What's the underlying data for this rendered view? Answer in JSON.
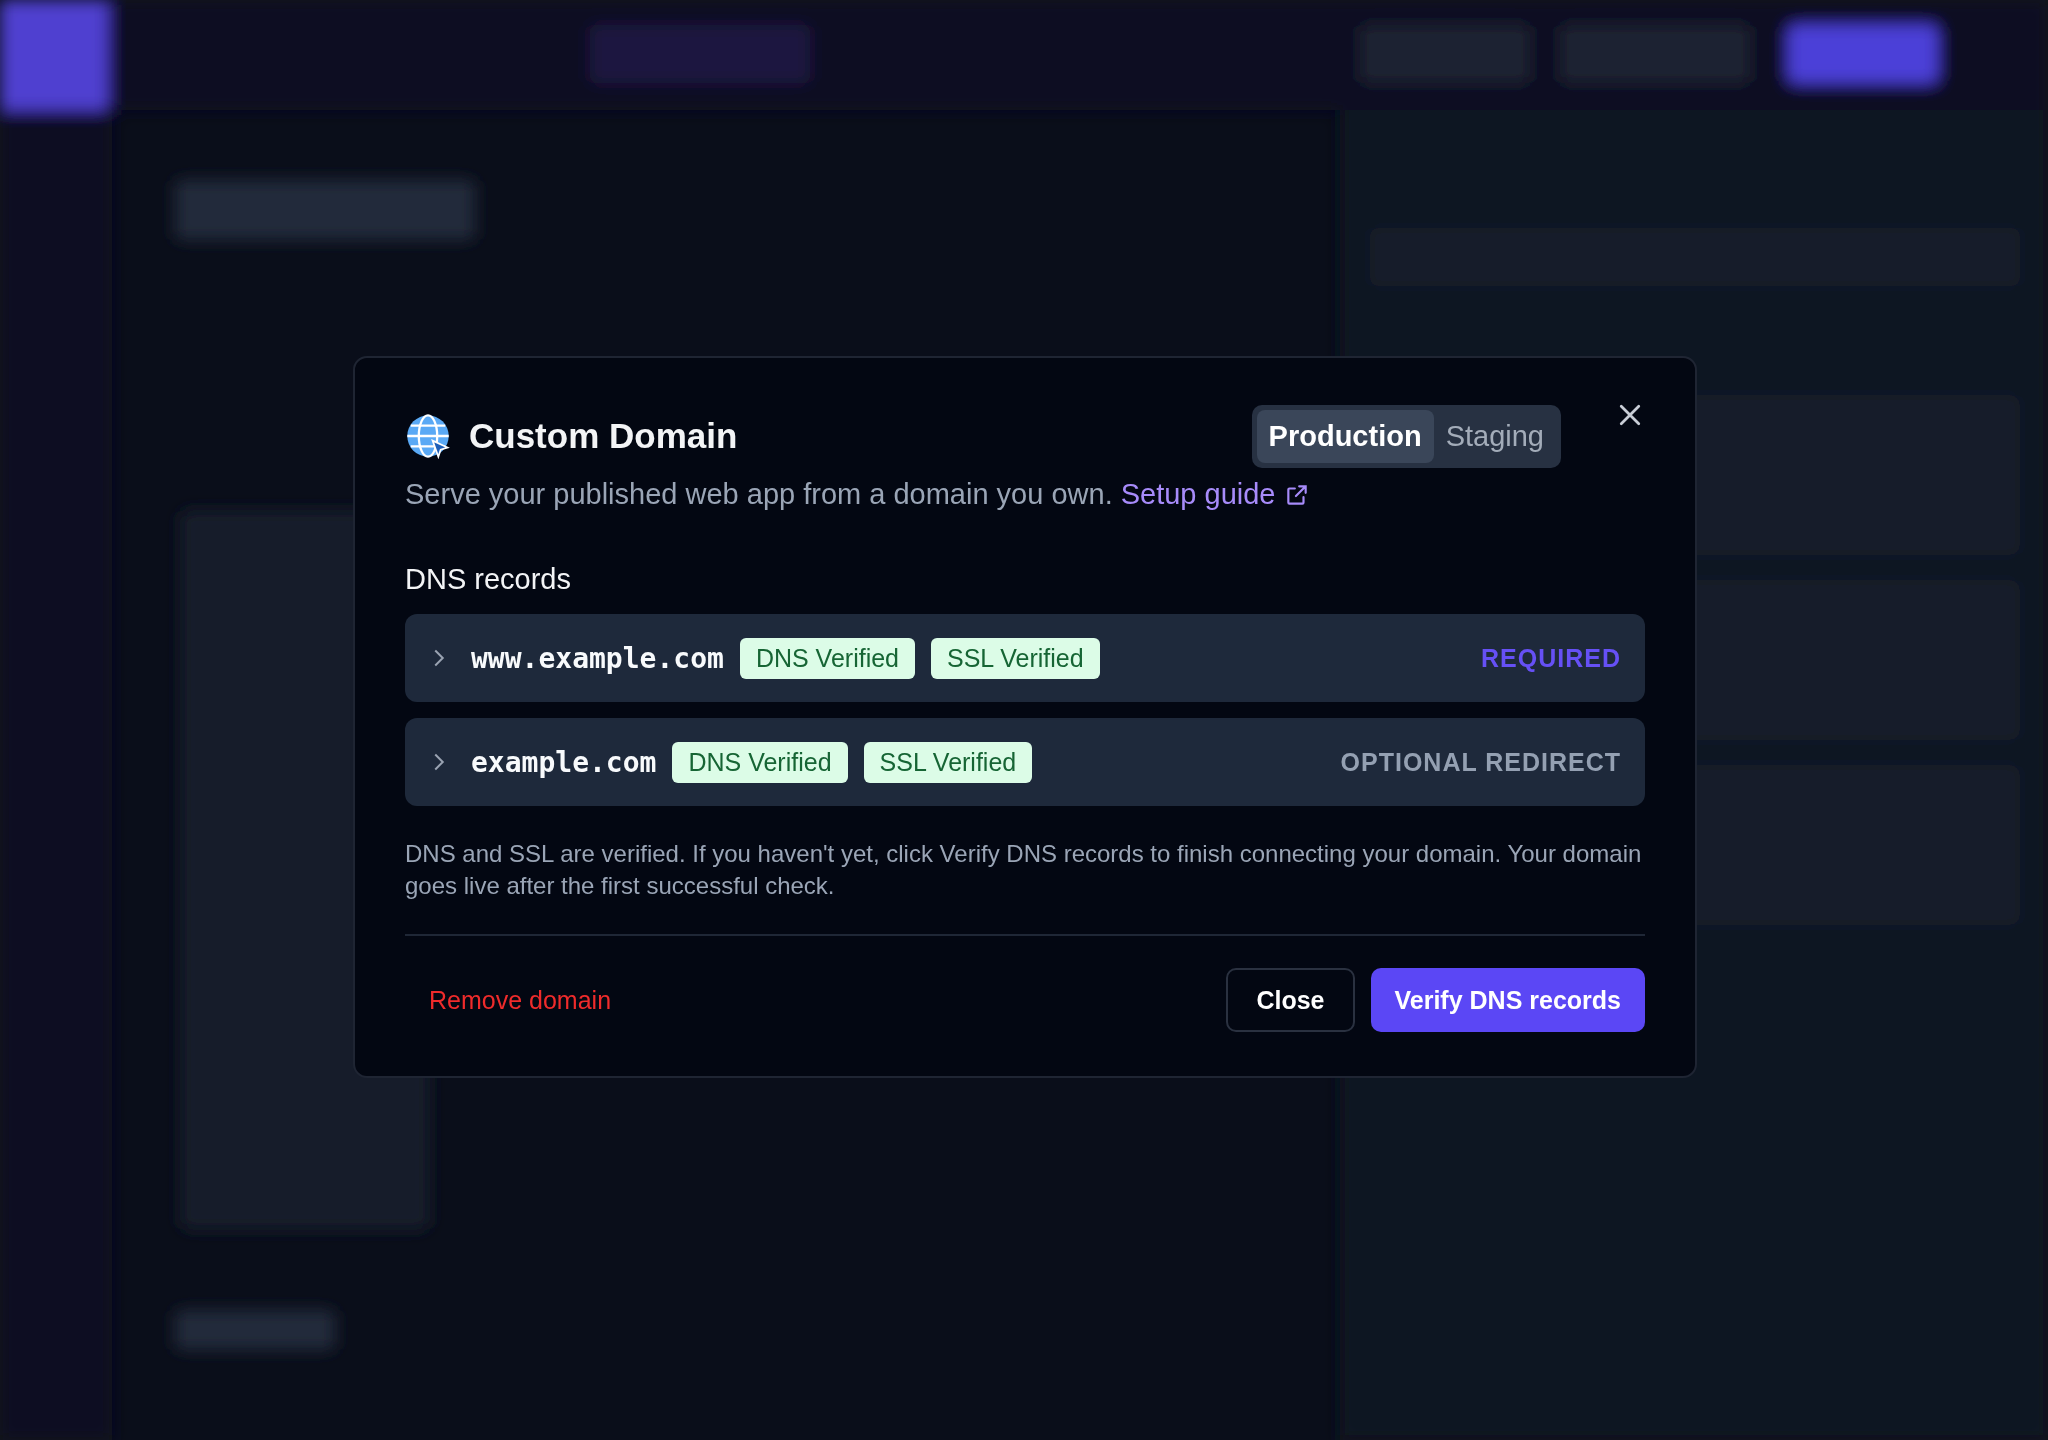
{
  "dialog": {
    "title": "Custom Domain",
    "environments": [
      {
        "label": "Production",
        "selected": true
      },
      {
        "label": "Staging",
        "selected": false
      }
    ],
    "description": "Serve your published web app from a domain you own.",
    "setup_link": "Setup guide",
    "section_title": "DNS records",
    "records": [
      {
        "domain": "www.example.com",
        "expanded": false,
        "badges": [
          {
            "label": "DNS Verified",
            "verified": true
          },
          {
            "label": "SSL Verified",
            "verified": true
          }
        ],
        "requirement": "REQUIRED",
        "kind": "required"
      },
      {
        "domain": "example.com",
        "expanded": false,
        "badges": [
          {
            "label": "DNS Verified",
            "verified": true
          },
          {
            "label": "SSL Verified",
            "verified": true
          }
        ],
        "requirement": "OPTIONAL REDIRECT",
        "kind": "optional"
      }
    ],
    "note": "DNS and SSL are verified. If you haven't yet, click Verify DNS records to finish connecting your domain. Your domain goes live after the first successful check.",
    "remove_button": "Remove domain",
    "close_button": "Close",
    "verify_button": "Verify DNS records"
  }
}
